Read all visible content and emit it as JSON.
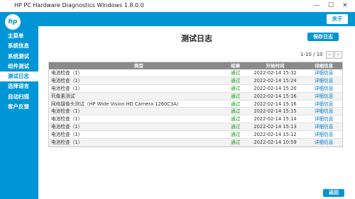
{
  "window": {
    "title": "HP PC Hardware Diagnostics Windows 1.8.0.0",
    "minimize": "—",
    "maximize": "☐",
    "close": "✕"
  },
  "logo_text": "hp",
  "sidebar": {
    "items": [
      {
        "label": "主菜单"
      },
      {
        "label": "系统信息"
      },
      {
        "label": "系统测试"
      },
      {
        "label": "组件测试"
      },
      {
        "label": "测试日志"
      },
      {
        "label": "选择语言"
      },
      {
        "label": "自动扫描"
      },
      {
        "label": "客户反馈"
      }
    ],
    "active_index": 4
  },
  "topbar": {
    "about_label": "关于"
  },
  "main": {
    "title": "测试日志",
    "save_label": "保存日志",
    "pager": {
      "text": "1-10 / 10",
      "prev": "‹",
      "next": "›"
    },
    "back_label": "返回"
  },
  "table": {
    "headers": [
      "类型",
      "结果",
      "开始时间",
      "详细信息"
    ],
    "rows": [
      {
        "type": "电池检查（1）",
        "result": "通过",
        "time": "2022-02-14 15:32",
        "detail": "详细信息"
      },
      {
        "type": "电池检查（1）",
        "result": "通过",
        "time": "2022-02-14 15:24",
        "detail": "详细信息"
      },
      {
        "type": "电池检查（1）",
        "result": "通过",
        "time": "2022-02-14 15:20",
        "detail": "详细信息"
      },
      {
        "type": "死像素测试",
        "result": "通过",
        "time": "2022-02-14 15:16",
        "detail": "详细信息"
      },
      {
        "type": "网络摄像头测试（HP Wide Vision HD Camera 1260C3A）",
        "result": "通过",
        "time": "2022-02-14 15:16",
        "detail": "详细信息"
      },
      {
        "type": "电池检查（1）",
        "result": "通过",
        "time": "2022-02-14 15:15",
        "detail": "详细信息"
      },
      {
        "type": "电池检查（1）",
        "result": "通过",
        "time": "2022-02-14 15:14",
        "detail": "详细信息"
      },
      {
        "type": "电池检查（1）",
        "result": "通过",
        "time": "2022-02-14 15:13",
        "detail": "详细信息"
      },
      {
        "type": "电池检查（1）",
        "result": "通过",
        "time": "2022-02-14 15:12",
        "detail": "详细信息"
      },
      {
        "type": "电池检查（1）",
        "result": "通过",
        "time": "2022-02-14 10:59",
        "detail": "详细信息"
      }
    ]
  },
  "colors": {
    "brand": "#0096d6",
    "pass": "#1a9a1a",
    "link": "#0077c8",
    "header_bg": "#8a8a8a"
  }
}
